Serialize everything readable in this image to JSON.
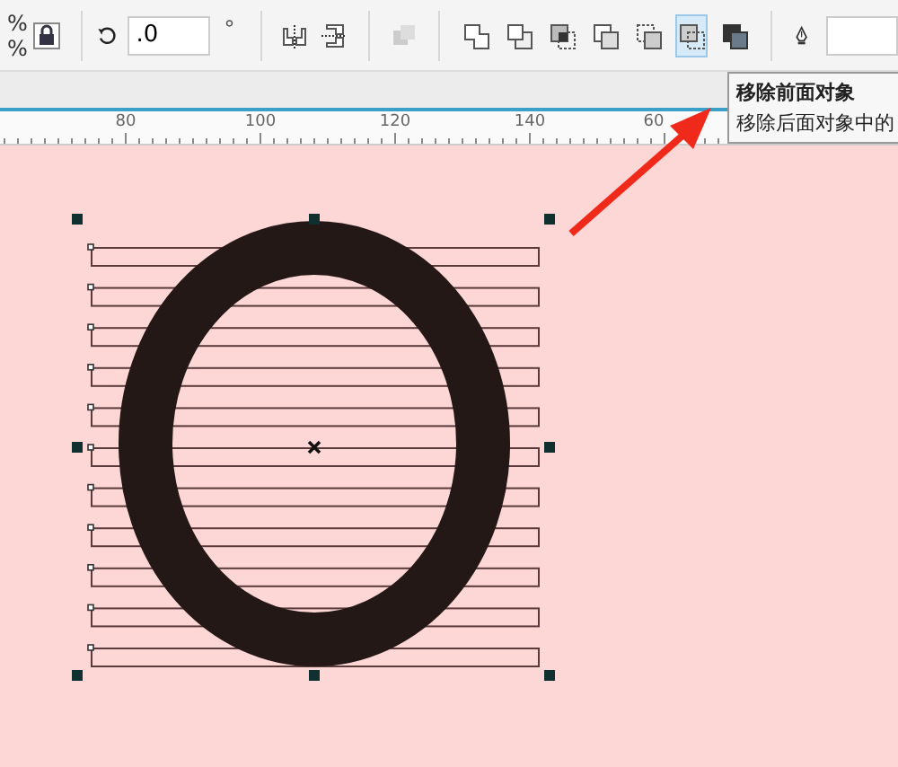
{
  "toolbar": {
    "scale_units": [
      "%",
      "%"
    ],
    "rotation_field": {
      "value": ".0"
    },
    "rotation_unit": "°",
    "group_button": {
      "disabled": true
    },
    "shaping_buttons": [
      {
        "kind": "weld",
        "selected": false
      },
      {
        "kind": "trim",
        "selected": false
      },
      {
        "kind": "intersect",
        "selected": false
      },
      {
        "kind": "simplify",
        "selected": false
      },
      {
        "kind": "front-minus-back",
        "selected": false
      },
      {
        "kind": "back-minus-front",
        "selected": true
      },
      {
        "kind": "boundary",
        "selected": false
      }
    ]
  },
  "tooltip": {
    "title": "移除前面对象",
    "text": "移除后面对象中的"
  },
  "ruler": {
    "labels": [
      "80",
      "100",
      "120",
      "140",
      "60"
    ]
  }
}
